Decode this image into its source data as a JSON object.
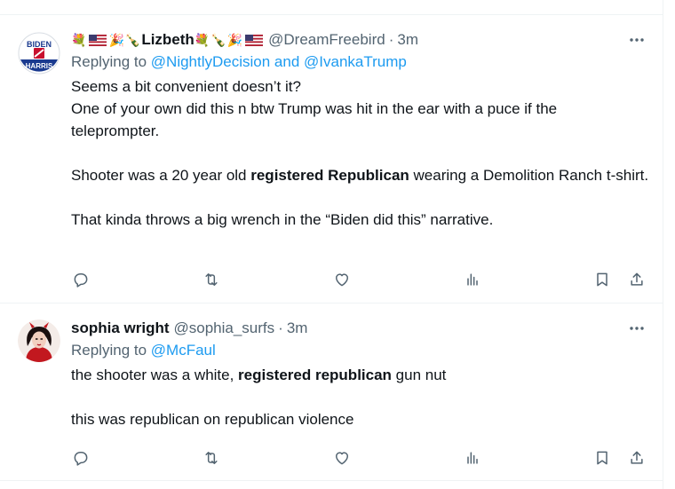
{
  "tweets": [
    {
      "display_name": "Lizbeth",
      "handle": "@DreamFreebird",
      "separator": "·",
      "time": "3m",
      "avatar_text": {
        "top": "BIDEN",
        "bottom": "HARRIS"
      },
      "replying_prefix": "Replying to ",
      "replying_users": "@NightlyDecision and @IvankaTrump",
      "lines": [
        "Seems a bit convenient doesn’t it?",
        "One of your own did this n btw Trump was hit in the ear with a puce if the teleprompter.",
        "",
        "Shooter was a 20 year old ",
        "registered Republican",
        " wearing a Demolition Ranch t-shirt.",
        "",
        "That kinda throws a big wrench in the “Biden did this” narrative."
      ]
    },
    {
      "display_name": "sophia wright",
      "handle": "@sophia_surfs",
      "separator": "·",
      "time": "3m",
      "replying_prefix": "Replying to ",
      "replying_users": "@McFaul",
      "lines": [
        "the shooter was a white, ",
        "registered republican",
        " gun nut",
        "",
        "this was republican on republican violence"
      ]
    }
  ],
  "icons": {
    "more": "more-horizontal-icon",
    "reply": "reply-icon",
    "retweet": "retweet-icon",
    "like": "heart-icon",
    "views": "views-icon",
    "bookmark": "bookmark-icon",
    "share": "share-icon"
  },
  "colors": {
    "link": "#1d9bf0",
    "secondary": "#536471",
    "text": "#0f1419",
    "divider": "#eff3f4",
    "avatar_blue": "#1a3a8f"
  }
}
